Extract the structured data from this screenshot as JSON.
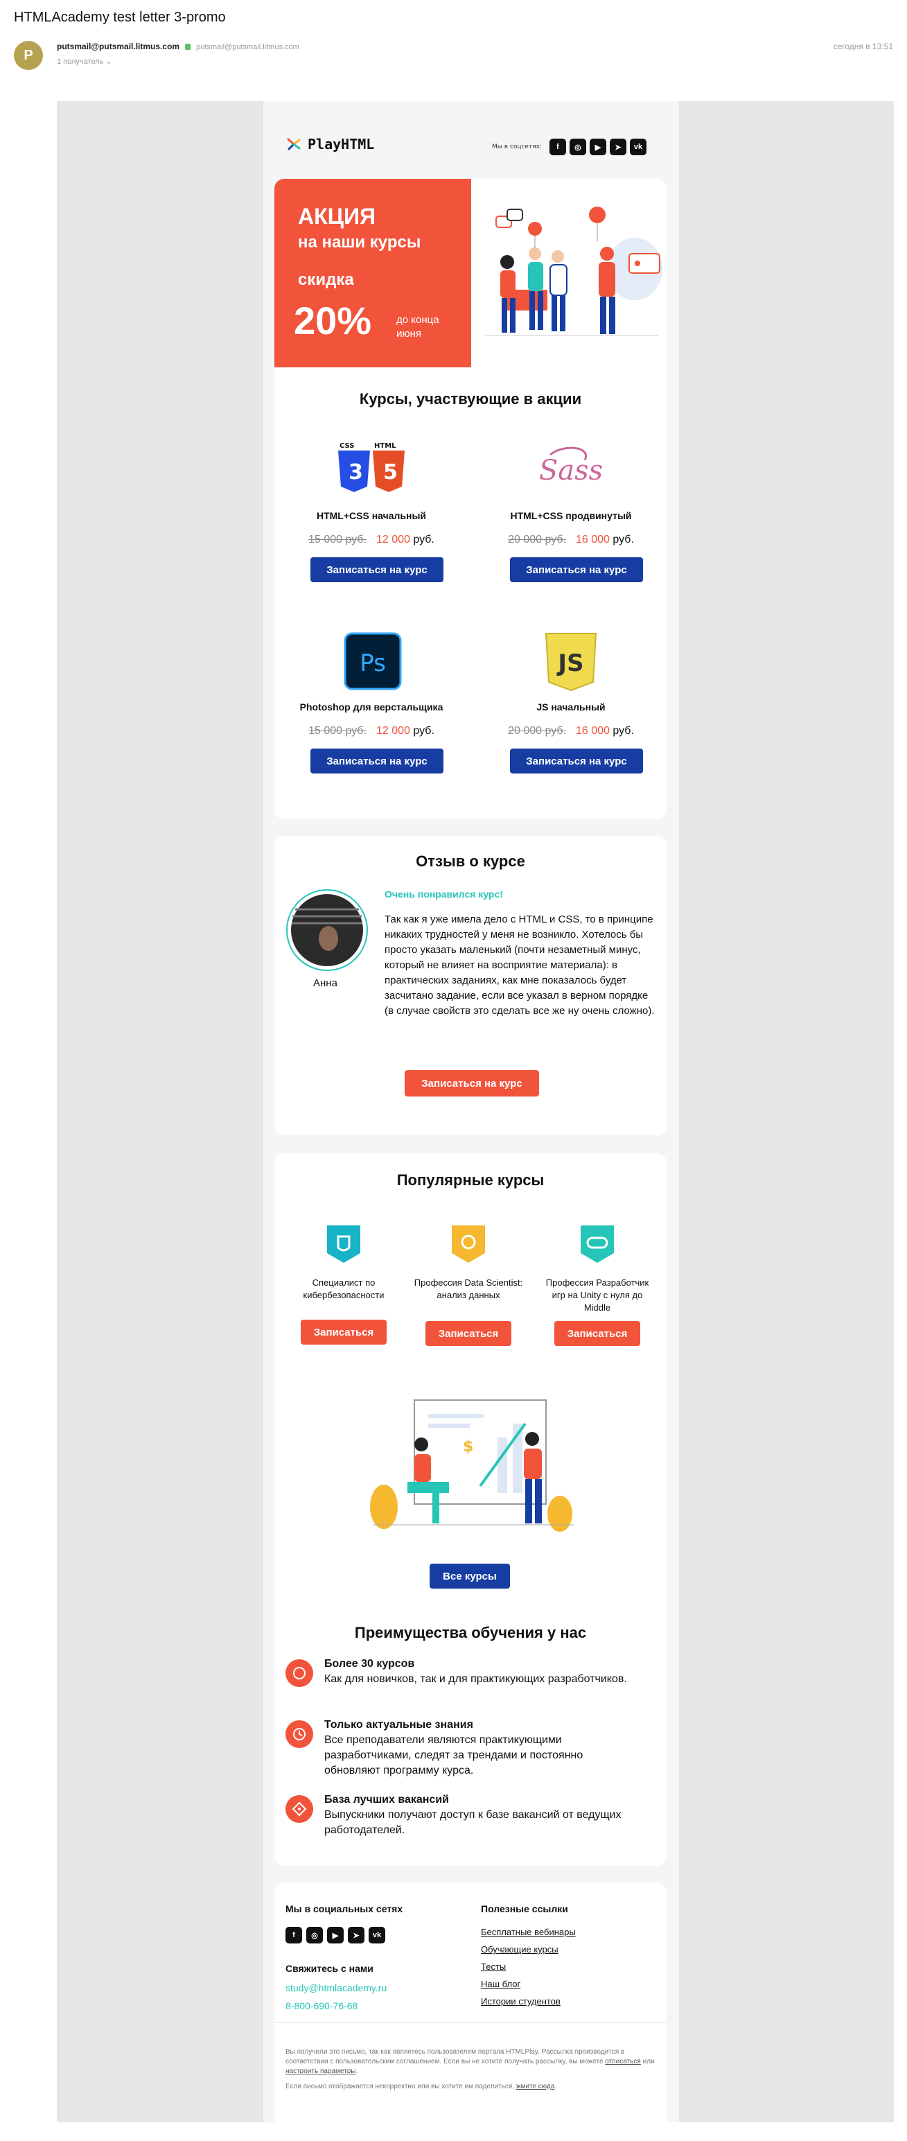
{
  "header": {
    "subject": "HTMLAcademy test letter 3-promo",
    "avatar_letter": "P",
    "sender_name": "putsmail@putsmail.litmus.com",
    "sender_email": "putsmail@putsmail.litmus.com",
    "recipients": "1 получатель",
    "date": "сегодня в 13:51"
  },
  "email": {
    "logo": "PlayHTML",
    "social_label": "Мы в соцсетях:",
    "social_icons": [
      "facebook-icon",
      "instagram-icon",
      "youtube-icon",
      "telegram-icon",
      "vk-icon"
    ],
    "banner": {
      "title": "АКЦИЯ",
      "subtitle": "на наши курсы",
      "discount_label": "скидка",
      "discount": "20%",
      "until": "до конца июня"
    },
    "courses_title": "Курсы, участвующие в акции",
    "courses": [
      {
        "title": "HTML+CSS начальный",
        "old_price": "15 000 руб.",
        "new_price": "12 000",
        "currency": "руб.",
        "button": "Записаться на курс"
      },
      {
        "title": "HTML+CSS продвинутый",
        "old_price": "20 000 руб.",
        "new_price": "16 000",
        "currency": "руб.",
        "button": "Записаться на курс"
      },
      {
        "title": "Photoshop для верстальщика",
        "old_price": "15 000 руб.",
        "new_price": "12 000",
        "currency": "руб.",
        "button": "Записаться на курс"
      },
      {
        "title": "JS начальный",
        "old_price": "20 000 руб.",
        "new_price": "16 000",
        "currency": "руб.",
        "button": "Записаться на курс"
      }
    ],
    "review": {
      "title": "Отзыв о курсе",
      "lead": "Очень понравился курс!",
      "text": "Так как я уже имела дело с HTML и CSS, то в принципе никаких трудностей у меня не возникло. Хотелось бы просто указать маленький (почти незаметный минус, который не влияет на восприятие материала): в практических заданиях, как мне показалось будет засчитано задание, если все указал в верном порядке (в случае свойств это сделать все же ну очень сложно).",
      "author": "Анна",
      "button": "Записаться на курс"
    },
    "popular": {
      "title": "Популярные курсы",
      "items": [
        {
          "name": "Специалист по кибербезопасности",
          "button": "Записаться",
          "color": "#17b3c7"
        },
        {
          "name": "Профессия Data Scientist: анализ данных",
          "button": "Записаться",
          "color": "#f5b82e"
        },
        {
          "name": "Профессия Разработчик игр на Unity с нуля до Middle",
          "button": "Записаться",
          "color": "#26c5b8"
        }
      ],
      "all_button": "Все курсы"
    },
    "advantages": {
      "title": "Преимущества обучения у нас",
      "items": [
        {
          "title": "Более 30 курсов",
          "text": "Как для новичков, так и для практикующих разработчиков."
        },
        {
          "title": "Только актуальные знания",
          "text": "Все преподаватели являются практикующими разработчиками, следят за трендами и постоянно обновляют программу курса."
        },
        {
          "title": "База лучших вакансий",
          "text": "Выпускники получают доступ к базе вакансий от ведущих работодателей."
        }
      ]
    },
    "footer": {
      "social_title": "Мы в социальных сетях",
      "contact_title": "Свяжитесь с нами",
      "email": "study@htmlacademy.ru",
      "phone": "8-800-690-76-68",
      "links_title": "Полезные ссылки",
      "links": [
        "Бесплатные вебинары",
        "Обучающие курсы",
        "Тесты",
        "Наш блог",
        "Истории студентов"
      ],
      "note1_a": "Вы получили это письмо, так как являетесь пользователем портала HTMLPlay. Рассылка производится в соответствии с пользовательским соглашением. Если вы не хотите получать рассылку, вы можете",
      "note1_unsub": "отписаться",
      "note1_or": "или",
      "note1_settings": "настроить параметры",
      "note2_a": "Если письмо отображается некорректно или вы хотите им поделиться,",
      "note2_link": "жмите сюда"
    },
    "colors": {
      "accent_red": "#f1533b",
      "accent_blue": "#173da3",
      "accent_teal": "#26c5b8"
    }
  }
}
